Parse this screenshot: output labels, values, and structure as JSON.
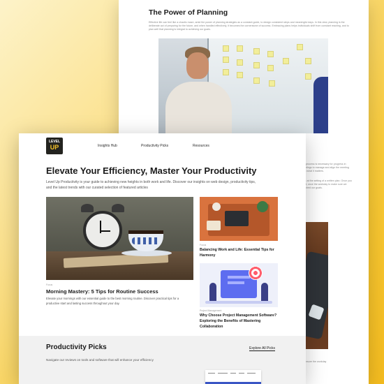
{
  "back_page": {
    "title": "The Power of Planning",
    "intro_text": "Effective life can feel like a chaotic maze, amid the power of planning strategies as a constant guide, to design consistent steps and meaningful days. In this view, planning is the deliberate act of preparing for the future, and when handled effectively, it becomes the cornerstone of success. Embracing plans helps individuals shift from constant reacting, and to plan well that planning is integral to achieving our goals.",
    "side_text_1": "the process is necessary for progress in meetings to manage and align the meeting with what it matters.",
    "side_text_2": "look at the setting of a written plan. Once you start, once the workday to make sure we reached our goals.",
    "side_text_3": "to ensure the workday"
  },
  "front_page": {
    "logo": {
      "line1": "LEVEL",
      "line2": "UP"
    },
    "nav": [
      "Insights Hub",
      "Productivity Picks",
      "Resources"
    ],
    "headline": "Elevate Your Efficiency, Master Your Productivity",
    "intro": "Level Up Productivity is your guide to achieving new heights in both work and life. Discover our insights on web design, productivity tips, and the latest trends with our curated selection of featured articles",
    "featured": {
      "category": "Focus",
      "title": "Morning Mastery: 5 Tips for Routine Success",
      "description": "Elevate your mornings with our essential guide to the best morning routine. Discover practical tips for a productive start and lasting success throughout your day."
    },
    "side_articles": [
      {
        "category": "Focus",
        "title": "Balancing Work and Life: Essential Tips for Harmony"
      },
      {
        "category": "Project Management",
        "title": "Why Choose Project Management Software? Exploring the Benefits of Mastering Collaboration"
      }
    ],
    "picks": {
      "title": "Productivity Picks",
      "link": "Explore All Picks",
      "description": "Navigate our reviews on tools and software that will enhance your efficiency"
    }
  },
  "colors": {
    "background_yellow": "#f7c937",
    "logo_dark": "#23231f",
    "logo_accent": "#f5c22b",
    "accent_blue": "#3a55c4"
  }
}
